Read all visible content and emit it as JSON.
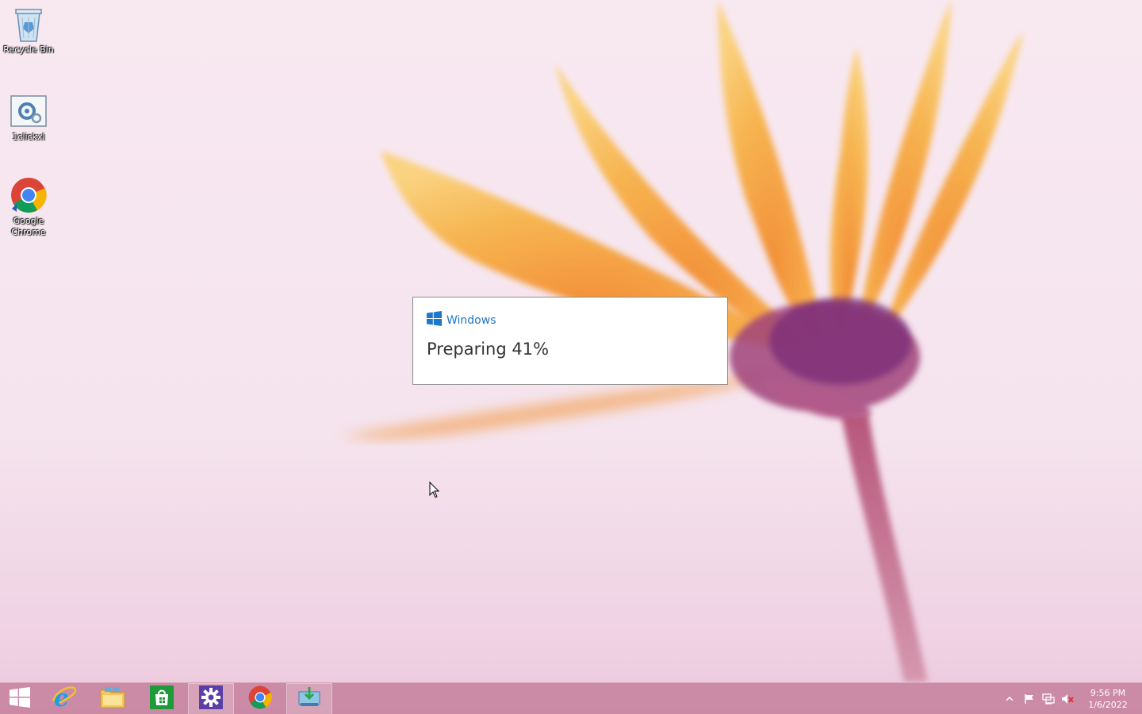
{
  "desktop": {
    "icons": [
      {
        "label": "Recycle Bin",
        "icon": "recycle-bin-icon"
      },
      {
        "label": "1clickxl",
        "icon": "settings-shortcut-icon"
      },
      {
        "label": "Google Chrome",
        "icon": "chrome-icon"
      }
    ]
  },
  "dialog": {
    "brand": "Windows",
    "status": "Preparing 41%",
    "progress_percent": 41
  },
  "taskbar": {
    "items": [
      {
        "name": "start",
        "icon": "windows-start-icon"
      },
      {
        "name": "internet-explorer",
        "icon": "internet-explorer-icon"
      },
      {
        "name": "file-explorer",
        "icon": "folder-icon"
      },
      {
        "name": "store",
        "icon": "store-icon"
      },
      {
        "name": "settings",
        "icon": "gear-icon",
        "active": true
      },
      {
        "name": "chrome",
        "icon": "chrome-icon"
      },
      {
        "name": "installer",
        "icon": "installer-icon",
        "active": true
      }
    ],
    "tray": {
      "icons": [
        "show-hidden-icons-chevron-icon",
        "action-center-flag-icon",
        "network-icon",
        "volume-muted-icon"
      ],
      "time": "9:56 PM",
      "date": "1/6/2022"
    }
  },
  "colors": {
    "accent": "#1e77c9",
    "taskbar": "#c27896",
    "wallpaper": "#f6e6ef"
  }
}
